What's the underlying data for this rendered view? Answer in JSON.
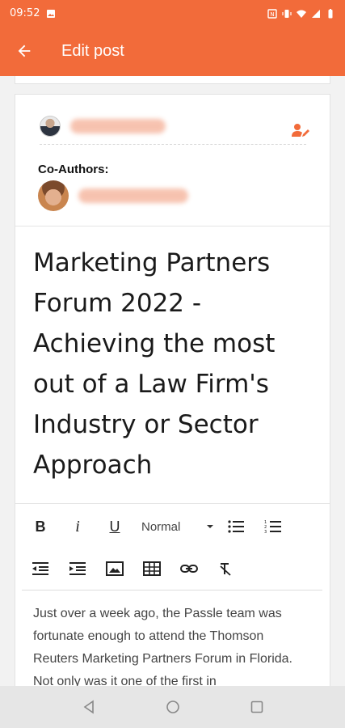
{
  "status_bar": {
    "time": "09:52",
    "icons": [
      "image-icon",
      "nfc-icon",
      "vibrate-icon",
      "wifi-icon",
      "signal-icon",
      "battery-icon"
    ]
  },
  "app_bar": {
    "title": "Edit post",
    "back_icon": "arrow-back-icon",
    "color": "#f26b3a"
  },
  "authors": {
    "primary_author_name": "",
    "edit_authors_icon": "person-edit-icon",
    "coauthors_label": "Co-Authors:",
    "coauthor_name": ""
  },
  "post": {
    "title": "Marketing Partners Forum 2022 - Achieving the most out of a Law Firm's Industry or Sector Approach",
    "body_preview": "Just over a week ago, the Passle team was fortunate enough to attend the Thomson Reuters Marketing Partners Forum in Florida. Not only was it one of the first in"
  },
  "toolbar": {
    "bold_label": "B",
    "italic_label": "i",
    "underline_label": "U",
    "format_select_value": "Normal",
    "buttons": [
      "bullet-list-icon",
      "numbered-list-icon",
      "outdent-icon",
      "indent-icon",
      "image-icon",
      "table-icon",
      "link-icon",
      "clear-format-icon"
    ]
  },
  "nav_bar": {
    "buttons": [
      "back-triangle-icon",
      "home-circle-icon",
      "recents-square-icon"
    ]
  }
}
